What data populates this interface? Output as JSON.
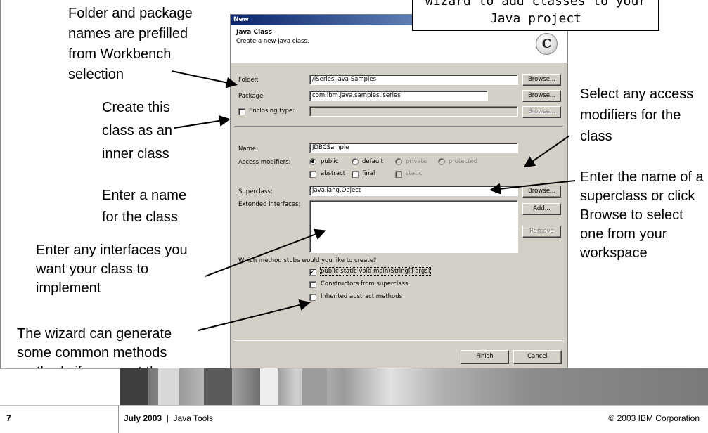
{
  "top_note": {
    "line1": "wizard to add classes to your",
    "line2": "Java project"
  },
  "callouts": {
    "folder": "Folder and package names are prefilled from Workbench selection",
    "inner": "Create this class as an inner class",
    "name": "Enter a name for the class",
    "interfaces": "Enter any interfaces you want your class to implement",
    "generate": "The wizard can generate some common methods methods if you want them",
    "access": "Select any access modifiers for the class",
    "superclass": "Enter the name of a superclass or click Browse to select one from your workspace"
  },
  "dialog": {
    "window_title": "New",
    "banner_title": "Java Class",
    "banner_desc": "Create a new Java class.",
    "banner_icon": "C",
    "folder_label": "Folder:",
    "folder_value": "/iSeries Java Samples",
    "package_label": "Package:",
    "package_value": "com.ibm.java.samples.iseries",
    "enclosing_label": "Enclosing type:",
    "browse_label": "Browse...",
    "name_label": "Name:",
    "name_value": "JDBCSample",
    "access_label": "Access modifiers:",
    "modifiers": {
      "public": "public",
      "default": "default",
      "private": "private",
      "protected": "protected",
      "abstract": "abstract",
      "final": "final",
      "static": "static"
    },
    "superclass_label": "Superclass:",
    "superclass_value": "java.lang.Object",
    "interfaces_label": "Extended interfaces:",
    "add_label": "Add...",
    "remove_label": "Remove",
    "stubs_question": "Which method stubs would you like to create?",
    "stub_main": "public static void main(String[] args)",
    "stub_constructors": "Constructors from superclass",
    "stub_inherited": "Inherited abstract methods",
    "finish_label": "Finish",
    "cancel_label": "Cancel",
    "checked_mark": "✓"
  },
  "footer": {
    "page_number": "7",
    "date": "July 2003",
    "separator": "|",
    "topic": "Java Tools",
    "copyright": "© 2003 IBM Corporation"
  }
}
